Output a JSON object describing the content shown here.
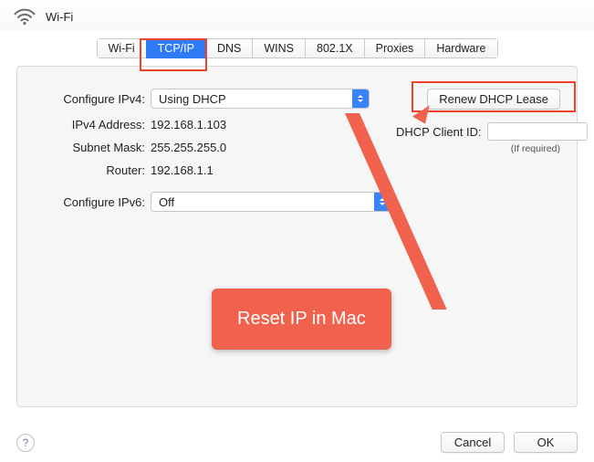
{
  "header": {
    "title": "Wi-Fi"
  },
  "tabs": {
    "items": [
      "Wi-Fi",
      "TCP/IP",
      "DNS",
      "WINS",
      "802.1X",
      "Proxies",
      "Hardware"
    ],
    "selected_index": 1
  },
  "form": {
    "configure_ipv4_label": "Configure IPv4:",
    "configure_ipv4_value": "Using DHCP",
    "ipv4_address_label": "IPv4 Address:",
    "ipv4_address_value": "192.168.1.103",
    "subnet_mask_label": "Subnet Mask:",
    "subnet_mask_value": "255.255.255.0",
    "router_label": "Router:",
    "router_value": "192.168.1.1",
    "configure_ipv6_label": "Configure IPv6:",
    "configure_ipv6_value": "Off"
  },
  "right": {
    "renew_button": "Renew DHCP Lease",
    "dhcp_client_id_label": "DHCP Client ID:",
    "dhcp_client_id_value": "",
    "if_required": "(If required)"
  },
  "footer": {
    "help": "?",
    "cancel": "Cancel",
    "ok": "OK"
  },
  "annotation": {
    "balloon_text": "Reset IP in Mac"
  }
}
